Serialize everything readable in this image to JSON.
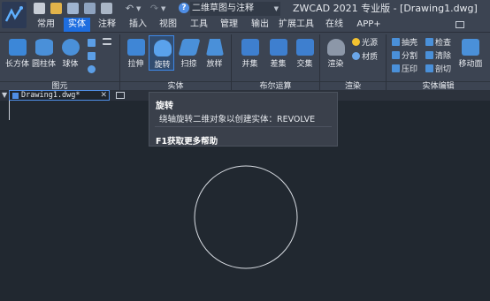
{
  "app": {
    "title": "ZWCAD 2021 专业版 - [Drawing1.dwg]",
    "workspace": "二维草图与注释"
  },
  "tabs": [
    {
      "label": "常用"
    },
    {
      "label": "实体",
      "active": true
    },
    {
      "label": "注释"
    },
    {
      "label": "插入"
    },
    {
      "label": "视图"
    },
    {
      "label": "工具"
    },
    {
      "label": "管理"
    },
    {
      "label": "输出"
    },
    {
      "label": "扩展工具"
    },
    {
      "label": "在线"
    },
    {
      "label": "APP+"
    }
  ],
  "ribbon": {
    "groups": {
      "primitives": "图元",
      "solid": "实体",
      "boolean": "布尔运算",
      "render": "渲染",
      "solid_edit": "实体编辑"
    },
    "primitives": {
      "box": "长方体",
      "cylinder": "圆柱体",
      "sphere": "球体"
    },
    "solid": {
      "extrude": "拉伸",
      "revolve": "旋转",
      "sweep": "扫掠",
      "loft": "放样"
    },
    "boolean": {
      "union": "并集",
      "subtract": "差集",
      "intersect": "交集"
    },
    "render": {
      "render": "渲染",
      "light": "光源",
      "material": "材质"
    },
    "solid_edit": {
      "shell": "抽壳",
      "check": "检查",
      "separate": "分割",
      "clean": "清除",
      "imprint": "压印",
      "slice": "剖切",
      "move_face": "移动面"
    }
  },
  "document": {
    "tab_name": "Drawing1.dwg*",
    "menu_glyph": "▼",
    "close_glyph": "✕"
  },
  "tooltip": {
    "title": "旋转",
    "description": "绕轴旋转二维对象以创建实体：REVOLVE",
    "help": "F1获取更多帮助"
  },
  "colors": {
    "accent": "#1e6ee0",
    "ribbon_bg": "#3c4452",
    "canvas_bg": "#212830",
    "circle": "#d9dde3"
  },
  "icons": {
    "new": "new-file-icon",
    "open": "open-folder-icon",
    "save": "save-icon",
    "undo": "undo-icon",
    "redo": "redo-icon"
  }
}
